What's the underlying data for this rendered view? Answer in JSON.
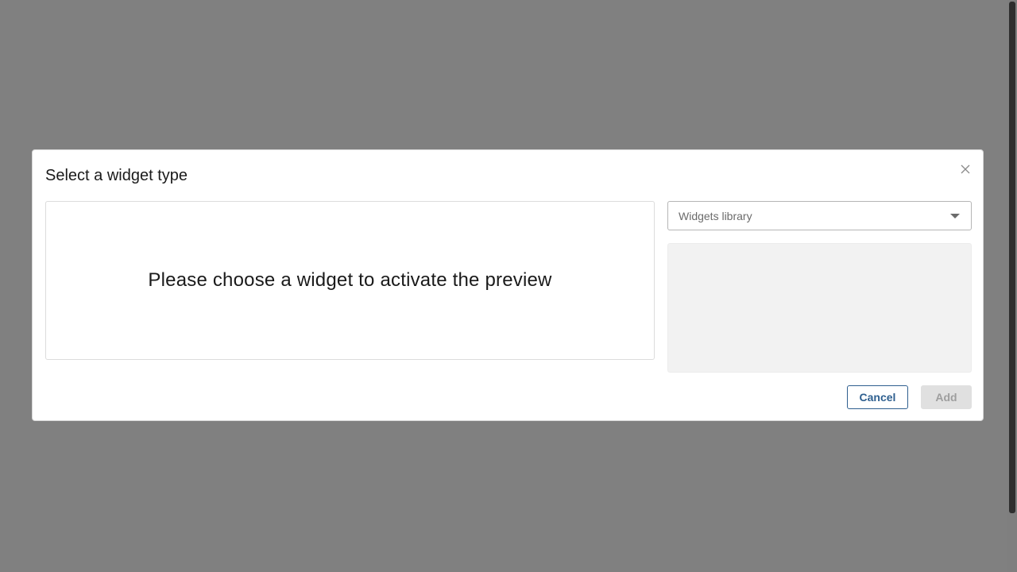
{
  "dialog": {
    "title": "Select a widget type",
    "preview_message": "Please choose a widget to activate the preview",
    "library_select": {
      "placeholder": "Widgets library"
    },
    "buttons": {
      "cancel": "Cancel",
      "add": "Add"
    }
  },
  "icons": {
    "close": "close-icon",
    "dropdown": "chevron-down-icon"
  },
  "colors": {
    "overlay": "#808080",
    "accent": "#2e5f8f",
    "disabled_bg": "#e0e0e0",
    "disabled_text": "#9e9e9e"
  }
}
